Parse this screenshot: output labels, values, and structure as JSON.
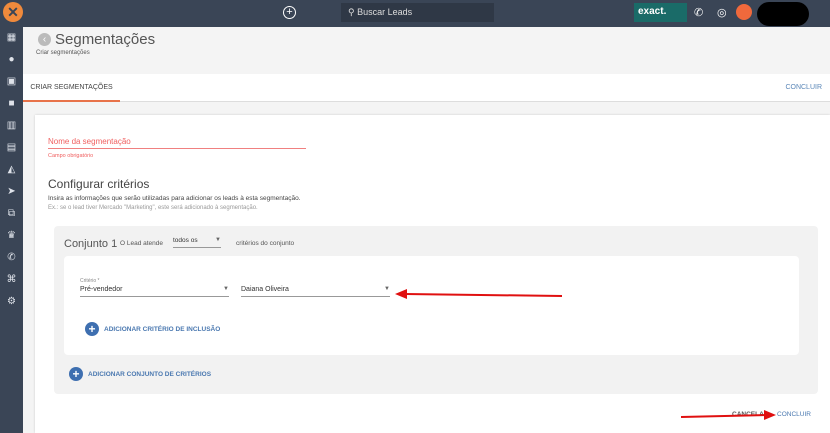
{
  "topbar": {
    "search_placeholder": "Buscar Leads",
    "brand": "exact.",
    "icons": [
      "add-icon",
      "search-icon",
      "phone-icon",
      "whatsapp-icon",
      "notification-icon"
    ]
  },
  "sidebar": {
    "icons": [
      "dashboard-icon",
      "person-icon",
      "contacts-icon",
      "briefcase-icon",
      "building-icon",
      "chart-icon",
      "megaphone-icon",
      "send-icon",
      "hierarchy-icon",
      "trophy-icon",
      "phone-icon",
      "map-icon",
      "gear-icon"
    ]
  },
  "header": {
    "title": "Segmentações",
    "breadcrumb": "Criar segmentações"
  },
  "tabs": {
    "active": "CRIAR SEGMENTAÇÕES",
    "conclude": "CONCLUIR"
  },
  "form": {
    "name_placeholder": "Nome da segmentação",
    "name_error": "Campo obrigatório",
    "criteria_title": "Configurar critérios",
    "criteria_desc": "Insira as informações que serão utilizadas para adicionar os leads à esta segmentação.",
    "criteria_example": "Ex.: se o lead tiver Mercado \"Marketing\", este será adicionado à segmentação."
  },
  "set": {
    "title": "Conjunto 1",
    "lead_label": "O Lead atende",
    "match_value": "todos os",
    "match_suffix": "critérios do conjunto",
    "criterion_label": "Critério *",
    "criterion_value": "Pré-vendedor",
    "criterion_option": "Daiana Oliveira",
    "add_criterion": "ADICIONAR CRITÉRIO DE INCLUSÃO"
  },
  "add_set": "ADICIONAR CONJUNTO DE CRITÉRIOS",
  "footer": {
    "cancel": "CANCELAR",
    "conclude": "CONCLUIR"
  },
  "colors": {
    "accent": "#e8734a",
    "link": "#4a78b0",
    "error": "#f06060",
    "annotation": "#e01010"
  }
}
